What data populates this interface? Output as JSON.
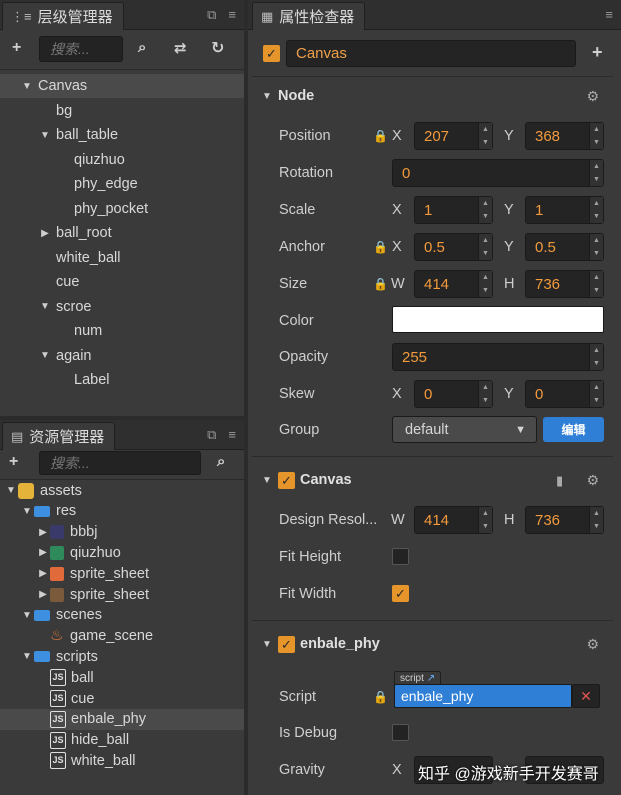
{
  "hierarchy": {
    "tab_title": "层级管理器",
    "search_placeholder": "搜索...",
    "nodes": [
      {
        "label": "Canvas",
        "level": 0,
        "expanded": true,
        "selected": true
      },
      {
        "label": "bg",
        "level": 1
      },
      {
        "label": "ball_table",
        "level": 1,
        "expanded": true
      },
      {
        "label": "qiuzhuo",
        "level": 2
      },
      {
        "label": "phy_edge",
        "level": 2
      },
      {
        "label": "phy_pocket",
        "level": 2
      },
      {
        "label": "ball_root",
        "level": 1,
        "expanded": false
      },
      {
        "label": "white_ball",
        "level": 1
      },
      {
        "label": "cue",
        "level": 1
      },
      {
        "label": "scroe",
        "level": 1,
        "expanded": true
      },
      {
        "label": "num",
        "level": 2
      },
      {
        "label": "again",
        "level": 1,
        "expanded": true
      },
      {
        "label": "Label",
        "level": 2
      }
    ]
  },
  "assets": {
    "tab_title": "资源管理器",
    "search_placeholder": "搜索...",
    "items": [
      {
        "label": "assets",
        "level": 0,
        "type": "db",
        "expanded": true
      },
      {
        "label": "res",
        "level": 1,
        "type": "folder",
        "expanded": true
      },
      {
        "label": "bbbj",
        "level": 2,
        "type": "image",
        "color": "#3a3a6a"
      },
      {
        "label": "qiuzhuo",
        "level": 2,
        "type": "image",
        "color": "#2e8a5a"
      },
      {
        "label": "sprite_sheet",
        "level": 2,
        "type": "image",
        "color": "#e06a3a"
      },
      {
        "label": "sprite_sheet",
        "level": 2,
        "type": "image",
        "color": "#7a5a3a"
      },
      {
        "label": "scenes",
        "level": 1,
        "type": "folder",
        "expanded": true
      },
      {
        "label": "game_scene",
        "level": 2,
        "type": "scene"
      },
      {
        "label": "scripts",
        "level": 1,
        "type": "folder",
        "expanded": true
      },
      {
        "label": "ball",
        "level": 2,
        "type": "js"
      },
      {
        "label": "cue",
        "level": 2,
        "type": "js"
      },
      {
        "label": "enbale_phy",
        "level": 2,
        "type": "js",
        "selected": true
      },
      {
        "label": "hide_ball",
        "level": 2,
        "type": "js"
      },
      {
        "label": "white_ball",
        "level": 2,
        "type": "js"
      }
    ]
  },
  "inspector": {
    "tab_title": "属性检查器",
    "node_name": "Canvas",
    "node_section": "Node",
    "props": {
      "position": {
        "label": "Position",
        "x": "207",
        "y": "368"
      },
      "rotation": {
        "label": "Rotation",
        "value": "0"
      },
      "scale": {
        "label": "Scale",
        "x": "1",
        "y": "1"
      },
      "anchor": {
        "label": "Anchor",
        "x": "0.5",
        "y": "0.5"
      },
      "size": {
        "label": "Size",
        "w": "414",
        "h": "736"
      },
      "color": {
        "label": "Color",
        "value": "#ffffff"
      },
      "opacity": {
        "label": "Opacity",
        "value": "255"
      },
      "skew": {
        "label": "Skew",
        "x": "0",
        "y": "0"
      },
      "group": {
        "label": "Group",
        "value": "default",
        "edit_label": "编辑"
      }
    },
    "canvas_section": "Canvas",
    "canvas": {
      "design_label": "Design Resol...",
      "w": "414",
      "h": "736",
      "fit_height_label": "Fit Height",
      "fit_width_label": "Fit Width"
    },
    "phy_section": "enbale_phy",
    "phy": {
      "script_label": "Script",
      "script_tag": "script",
      "script_value": "enbale_phy",
      "debug_label": "Is Debug",
      "gravity_label": "Gravity"
    },
    "axis": {
      "x": "X",
      "y": "Y",
      "w": "W",
      "h": "H"
    }
  },
  "watermark": "知乎 @游戏新手开发赛哥",
  "colors": {
    "accent": "#e6952b",
    "value": "#f29a3c",
    "selection": "#3d8fe0"
  }
}
